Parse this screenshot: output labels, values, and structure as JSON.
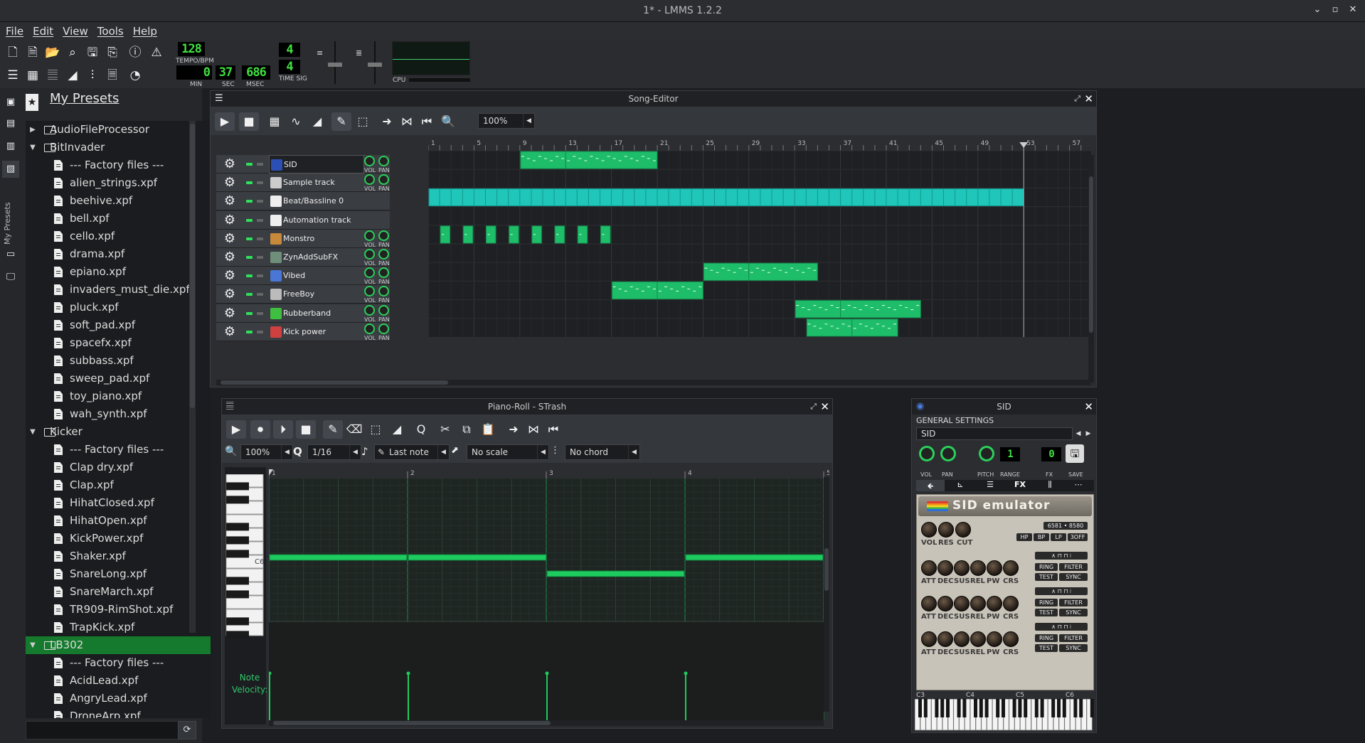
{
  "window": {
    "title": "1* - LMMS 1.2.2"
  },
  "menu": [
    "File",
    "Edit",
    "View",
    "Tools",
    "Help"
  ],
  "transport": {
    "tempo": "128",
    "tempo_label": "TEMPO/BPM",
    "time_min": "0",
    "time_sec": "37",
    "time_msec": "686",
    "min_label": "MIN",
    "sec_label": "SEC",
    "msec_label": "MSEC",
    "timesig_num": "4",
    "timesig_den": "4",
    "timesig_label": "TIME SIG",
    "cpu_label": "CPU"
  },
  "presets": {
    "title": "My Presets",
    "side_tab": "My Presets",
    "tree": [
      {
        "label": "AudioFileProcessor",
        "type": "folder",
        "expanded": false,
        "depth": 0
      },
      {
        "label": "BitInvader",
        "type": "folder",
        "expanded": true,
        "depth": 0
      },
      {
        "label": "--- Factory files ---",
        "type": "file",
        "depth": 1
      },
      {
        "label": "alien_strings.xpf",
        "type": "file",
        "depth": 1
      },
      {
        "label": "beehive.xpf",
        "type": "file",
        "depth": 1
      },
      {
        "label": "bell.xpf",
        "type": "file",
        "depth": 1
      },
      {
        "label": "cello.xpf",
        "type": "file",
        "depth": 1
      },
      {
        "label": "drama.xpf",
        "type": "file",
        "depth": 1
      },
      {
        "label": "epiano.xpf",
        "type": "file",
        "depth": 1
      },
      {
        "label": "invaders_must_die.xpf",
        "type": "file",
        "depth": 1
      },
      {
        "label": "pluck.xpf",
        "type": "file",
        "depth": 1
      },
      {
        "label": "soft_pad.xpf",
        "type": "file",
        "depth": 1
      },
      {
        "label": "spacefx.xpf",
        "type": "file",
        "depth": 1
      },
      {
        "label": "subbass.xpf",
        "type": "file",
        "depth": 1
      },
      {
        "label": "sweep_pad.xpf",
        "type": "file",
        "depth": 1
      },
      {
        "label": "toy_piano.xpf",
        "type": "file",
        "depth": 1
      },
      {
        "label": "wah_synth.xpf",
        "type": "file",
        "depth": 1
      },
      {
        "label": "Kicker",
        "type": "folder",
        "expanded": true,
        "depth": 0
      },
      {
        "label": "--- Factory files ---",
        "type": "file",
        "depth": 1
      },
      {
        "label": "Clap dry.xpf",
        "type": "file",
        "depth": 1
      },
      {
        "label": "Clap.xpf",
        "type": "file",
        "depth": 1
      },
      {
        "label": "HihatClosed.xpf",
        "type": "file",
        "depth": 1
      },
      {
        "label": "HihatOpen.xpf",
        "type": "file",
        "depth": 1
      },
      {
        "label": "KickPower.xpf",
        "type": "file",
        "depth": 1
      },
      {
        "label": "Shaker.xpf",
        "type": "file",
        "depth": 1
      },
      {
        "label": "SnareLong.xpf",
        "type": "file",
        "depth": 1
      },
      {
        "label": "SnareMarch.xpf",
        "type": "file",
        "depth": 1
      },
      {
        "label": "TR909-RimShot.xpf",
        "type": "file",
        "depth": 1
      },
      {
        "label": "TrapKick.xpf",
        "type": "file",
        "depth": 1
      },
      {
        "label": "LB302",
        "type": "folder",
        "expanded": true,
        "depth": 0,
        "selected": true
      },
      {
        "label": "--- Factory files ---",
        "type": "file",
        "depth": 1
      },
      {
        "label": "AcidLead.xpf",
        "type": "file",
        "depth": 1
      },
      {
        "label": "AngryLead.xpf",
        "type": "file",
        "depth": 1
      },
      {
        "label": "DroneArp.xpf",
        "type": "file",
        "depth": 1
      }
    ]
  },
  "song_editor": {
    "title": "Song-Editor",
    "zoom": "100%",
    "bars": [
      "1",
      "5",
      "9",
      "13",
      "17",
      "21",
      "25",
      "29",
      "33",
      "37",
      "41",
      "45",
      "49",
      "53",
      "57"
    ],
    "knob_vol": "VOL",
    "knob_pan": "PAN",
    "tracks": [
      {
        "name": "SID",
        "icon": "sid-icon",
        "knobs": true
      },
      {
        "name": "Sample track",
        "icon": "waveform-icon",
        "knobs": true
      },
      {
        "name": "Beat/Bassline 0",
        "icon": "beat-grid-icon",
        "knobs": false
      },
      {
        "name": "Automation track",
        "icon": "automation-icon",
        "knobs": false
      },
      {
        "name": "Monstro",
        "icon": "monstro-icon",
        "knobs": true
      },
      {
        "name": "ZynAddSubFX",
        "icon": "zyn-icon",
        "knobs": true
      },
      {
        "name": "Vibed",
        "icon": "vibed-icon",
        "knobs": true
      },
      {
        "name": "FreeBoy",
        "icon": "gameboy-icon",
        "knobs": true
      },
      {
        "name": "Rubberband",
        "icon": "rubberband-icon",
        "knobs": true
      },
      {
        "name": "Kick power",
        "icon": "kick-icon",
        "knobs": true
      }
    ]
  },
  "piano_roll": {
    "title": "Piano-Roll - STrash",
    "zoom": "100%",
    "quantize": "1/16",
    "note_length": "Last note",
    "scale": "No scale",
    "chord": "No chord",
    "bars": [
      "1",
      "2",
      "3",
      "4",
      "5"
    ],
    "key_label": "C6",
    "velocity_label": "Note\nVelocity:"
  },
  "sid": {
    "title": "SID",
    "section": "GENERAL SETTINGS",
    "preset_name": "SID",
    "knob_labels": [
      "VOL",
      "PAN",
      "PITCH",
      "RANGE",
      "FX",
      "SAVE"
    ],
    "range_value": "1",
    "fx_value": "0",
    "tabs": [
      "plugin-tab",
      "envelope-tab",
      "arpeggio-tab",
      "FX",
      "midi-tab",
      "more-tab"
    ],
    "emulator_title": "SID emulator",
    "chip_models": [
      "6581",
      "8580"
    ],
    "filter_knobs": [
      "VOL",
      "RES",
      "CUT"
    ],
    "filter_modes": [
      "HP",
      "BP",
      "LP",
      "3OFF"
    ],
    "voice_knobs": [
      "ATT",
      "DEC",
      "SUS",
      "REL",
      "PW",
      "CRS"
    ],
    "voice_buttons": [
      "RING",
      "FILTER",
      "TEST",
      "SYNC"
    ],
    "piano_octaves": [
      "C3",
      "C4",
      "C5",
      "C6"
    ]
  }
}
